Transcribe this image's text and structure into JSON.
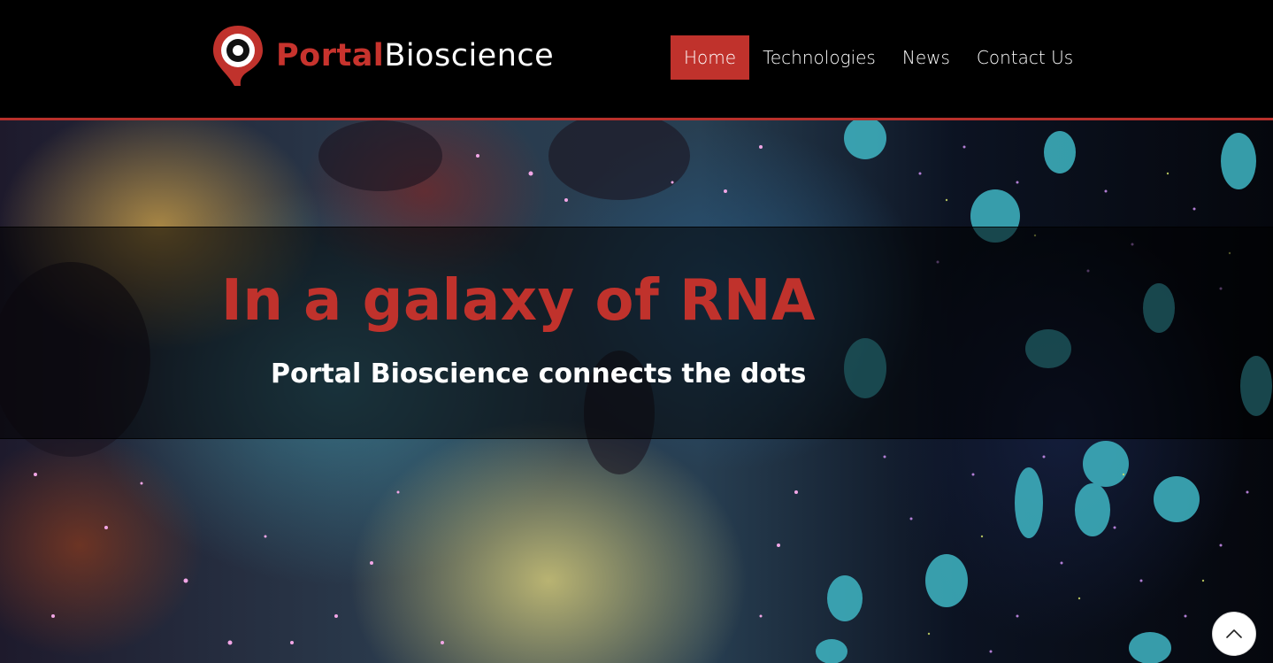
{
  "brand": {
    "name_part1": "Portal",
    "name_part2": "Bioscience",
    "logo_icon": "map-pin-eye-icon",
    "accent_color": "#c0322c"
  },
  "nav": {
    "items": [
      {
        "label": "Home",
        "active": true
      },
      {
        "label": "Technologies",
        "active": false
      },
      {
        "label": "News",
        "active": false
      },
      {
        "label": "Contact Us",
        "active": false
      }
    ]
  },
  "hero": {
    "title": "In a galaxy of RNA",
    "subtitle": "Portal Bioscience connects the dots"
  },
  "scroll_top": {
    "icon": "chevron-up-icon"
  }
}
